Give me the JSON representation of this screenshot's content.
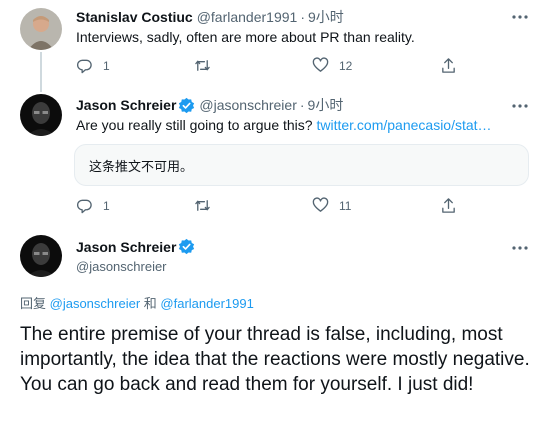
{
  "tweet1": {
    "name": "Stanislav Costiuc",
    "handle": "@farlander1991",
    "separator": "·",
    "time": "9小时",
    "text": "Interviews, sadly, often are more about PR than reality.",
    "reply_count": "1",
    "like_count": "12"
  },
  "tweet2": {
    "name": "Jason Schreier",
    "handle": "@jasonschreier",
    "separator": "·",
    "time": "9小时",
    "text_prefix": "Are you really still going to argue this?",
    "link": "twitter.com/panecasio/stat…",
    "quote_unavailable": "这条推文不可用。",
    "reply_count": "1",
    "like_count": "11"
  },
  "main_tweet": {
    "name": "Jason Schreier",
    "handle": "@jasonschreier",
    "reply_prefix": "回复",
    "reply_to_1": "@jasonschreier",
    "reply_and": "和",
    "reply_to_2": "@farlander1991",
    "text": "The entire premise of your thread is false, including, most importantly, the idea that the reactions were mostly negative. You can go back and read them for yourself. I just did!"
  },
  "icons": {
    "reply": "reply-icon",
    "retweet": "retweet-icon",
    "like": "heart-icon",
    "share": "share-icon",
    "more": "more-icon",
    "verified": "verified-badge-icon"
  },
  "colors": {
    "link": "#1d9bf0",
    "verified": "#1d9bf0",
    "secondary_text": "#536471",
    "primary_text": "#0f1419"
  }
}
